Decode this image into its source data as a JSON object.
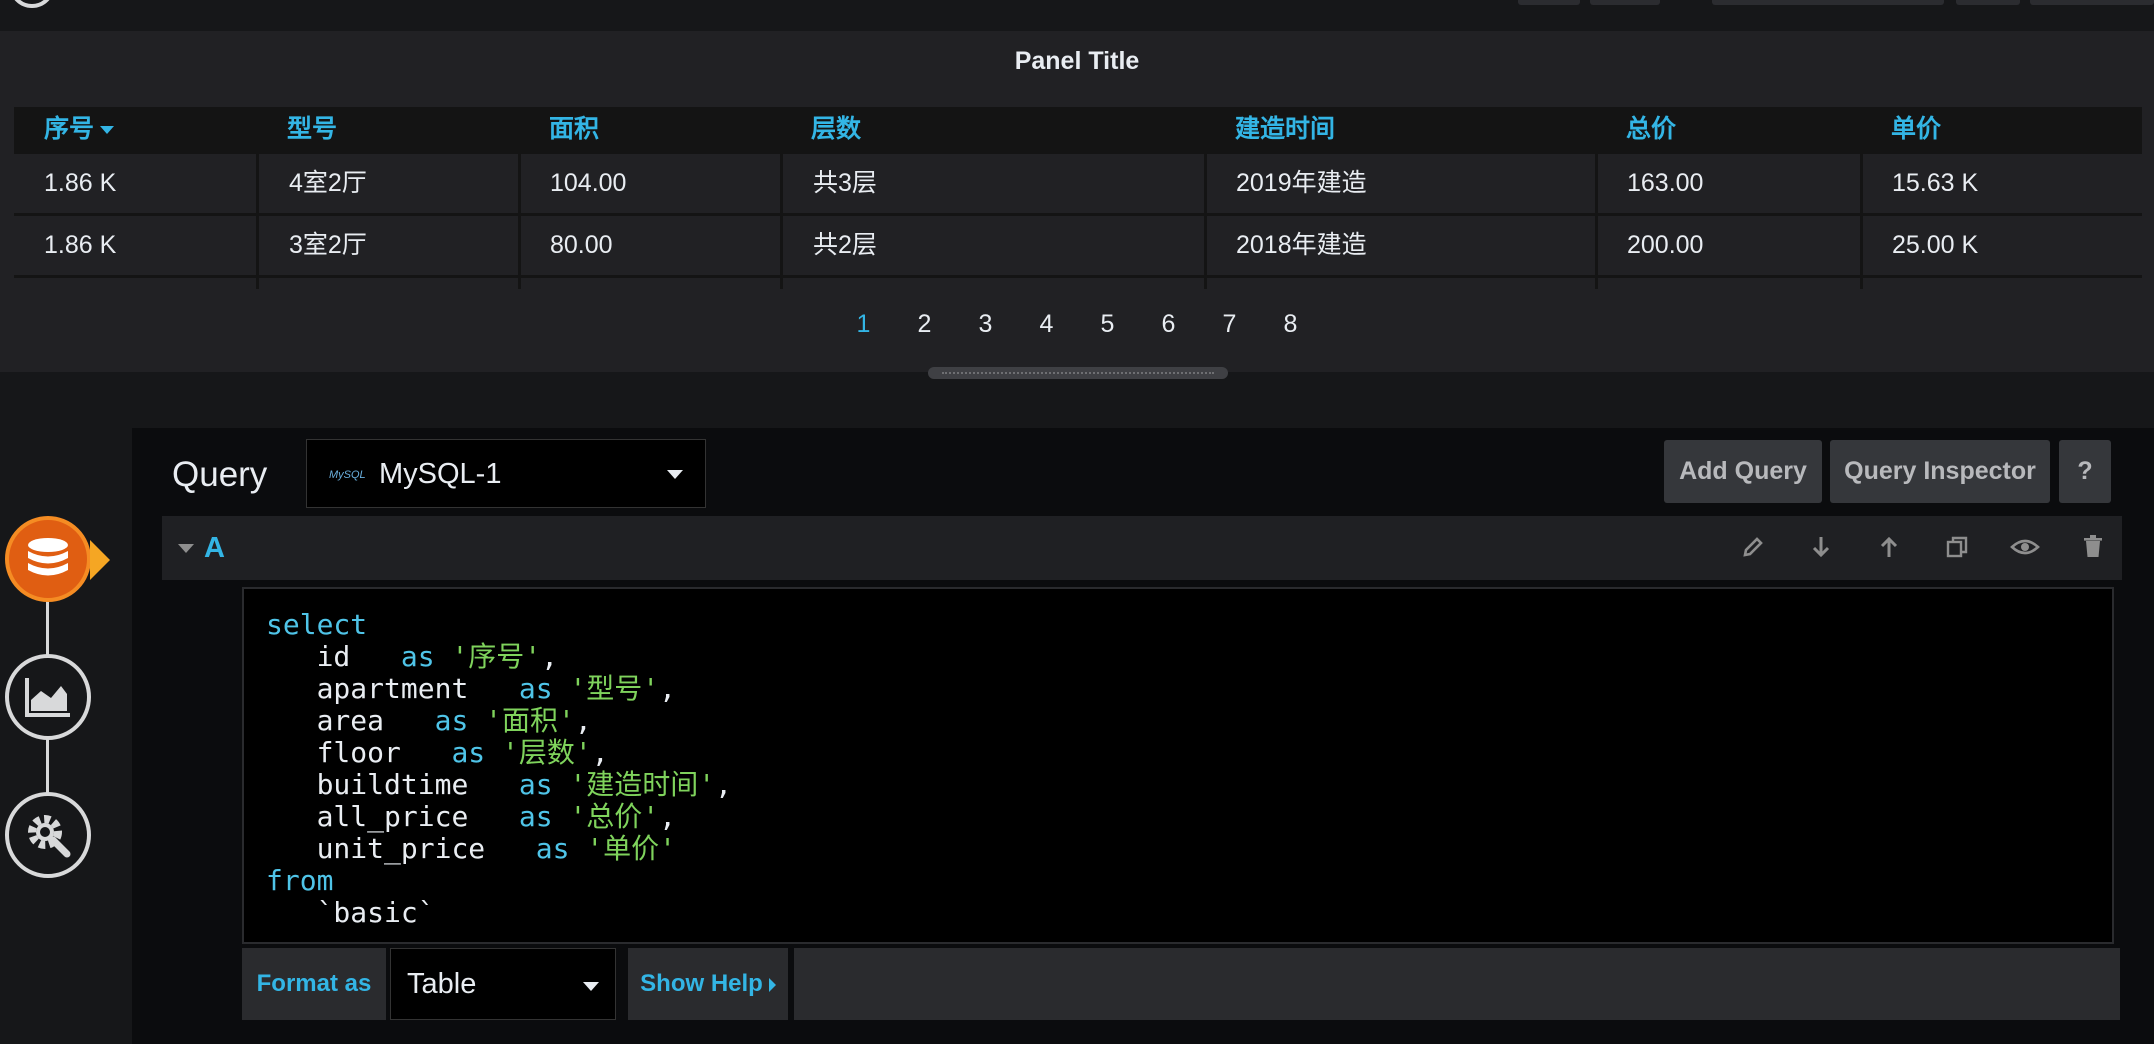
{
  "panel": {
    "title": "Panel Title",
    "columns": [
      "序号",
      "型号",
      "面积",
      "层数",
      "建造时间",
      "总价",
      "单价"
    ],
    "rows": [
      [
        "1.86 K",
        "4室2厅",
        "104.00",
        "共3层",
        "2019年建造",
        "163.00",
        "15.63 K"
      ],
      [
        "1.86 K",
        "3室2厅",
        "80.00",
        "共2层",
        "2018年建造",
        "200.00",
        "25.00 K"
      ]
    ],
    "sort_column": "序号",
    "pages": [
      "1",
      "2",
      "3",
      "4",
      "5",
      "6",
      "7",
      "8"
    ],
    "current_page": "1"
  },
  "query_editor": {
    "label": "Query",
    "datasource": {
      "name": "MySQL-1",
      "logo_text": "MySQL"
    },
    "buttons": {
      "add_query": "Add Query",
      "query_inspector": "Query Inspector",
      "help": "?"
    },
    "query": {
      "ref_id": "A",
      "row_icons": [
        "pencil-icon",
        "arrow-down-icon",
        "arrow-up-icon",
        "duplicate-icon",
        "eye-icon",
        "trash-icon"
      ],
      "sql": {
        "select_kw": "select",
        "fields": [
          {
            "column": "id",
            "alias": "'序号'",
            "sep": ","
          },
          {
            "column": "apartment",
            "alias": "'型号'",
            "sep": ","
          },
          {
            "column": "area",
            "alias": "'面积'",
            "sep": ","
          },
          {
            "column": "floor",
            "alias": "'层数'",
            "sep": ","
          },
          {
            "column": "buildtime",
            "alias": "'建造时间'",
            "sep": ","
          },
          {
            "column": "all_price",
            "alias": "'总价'",
            "sep": ","
          },
          {
            "column": "unit_price",
            "alias": "'单价'",
            "sep": ""
          }
        ],
        "as_kw": "as",
        "from_kw": "from",
        "table": "`basic`"
      }
    },
    "format_as": {
      "label": "Format as",
      "value": "Table"
    },
    "show_help": "Show Help"
  },
  "side_nav": {
    "items": [
      {
        "icon": "database-icon",
        "active": true
      },
      {
        "icon": "area-chart-icon",
        "active": false
      },
      {
        "icon": "settings-icon",
        "active": false
      }
    ]
  },
  "colors": {
    "accent": "#33b5e5",
    "active_nav": "#e05e12",
    "panel_bg": "#212124",
    "editor_bg": "#0b0c0e",
    "sql_keyword": "#4fc4e8",
    "sql_string": "#7fd35c"
  }
}
